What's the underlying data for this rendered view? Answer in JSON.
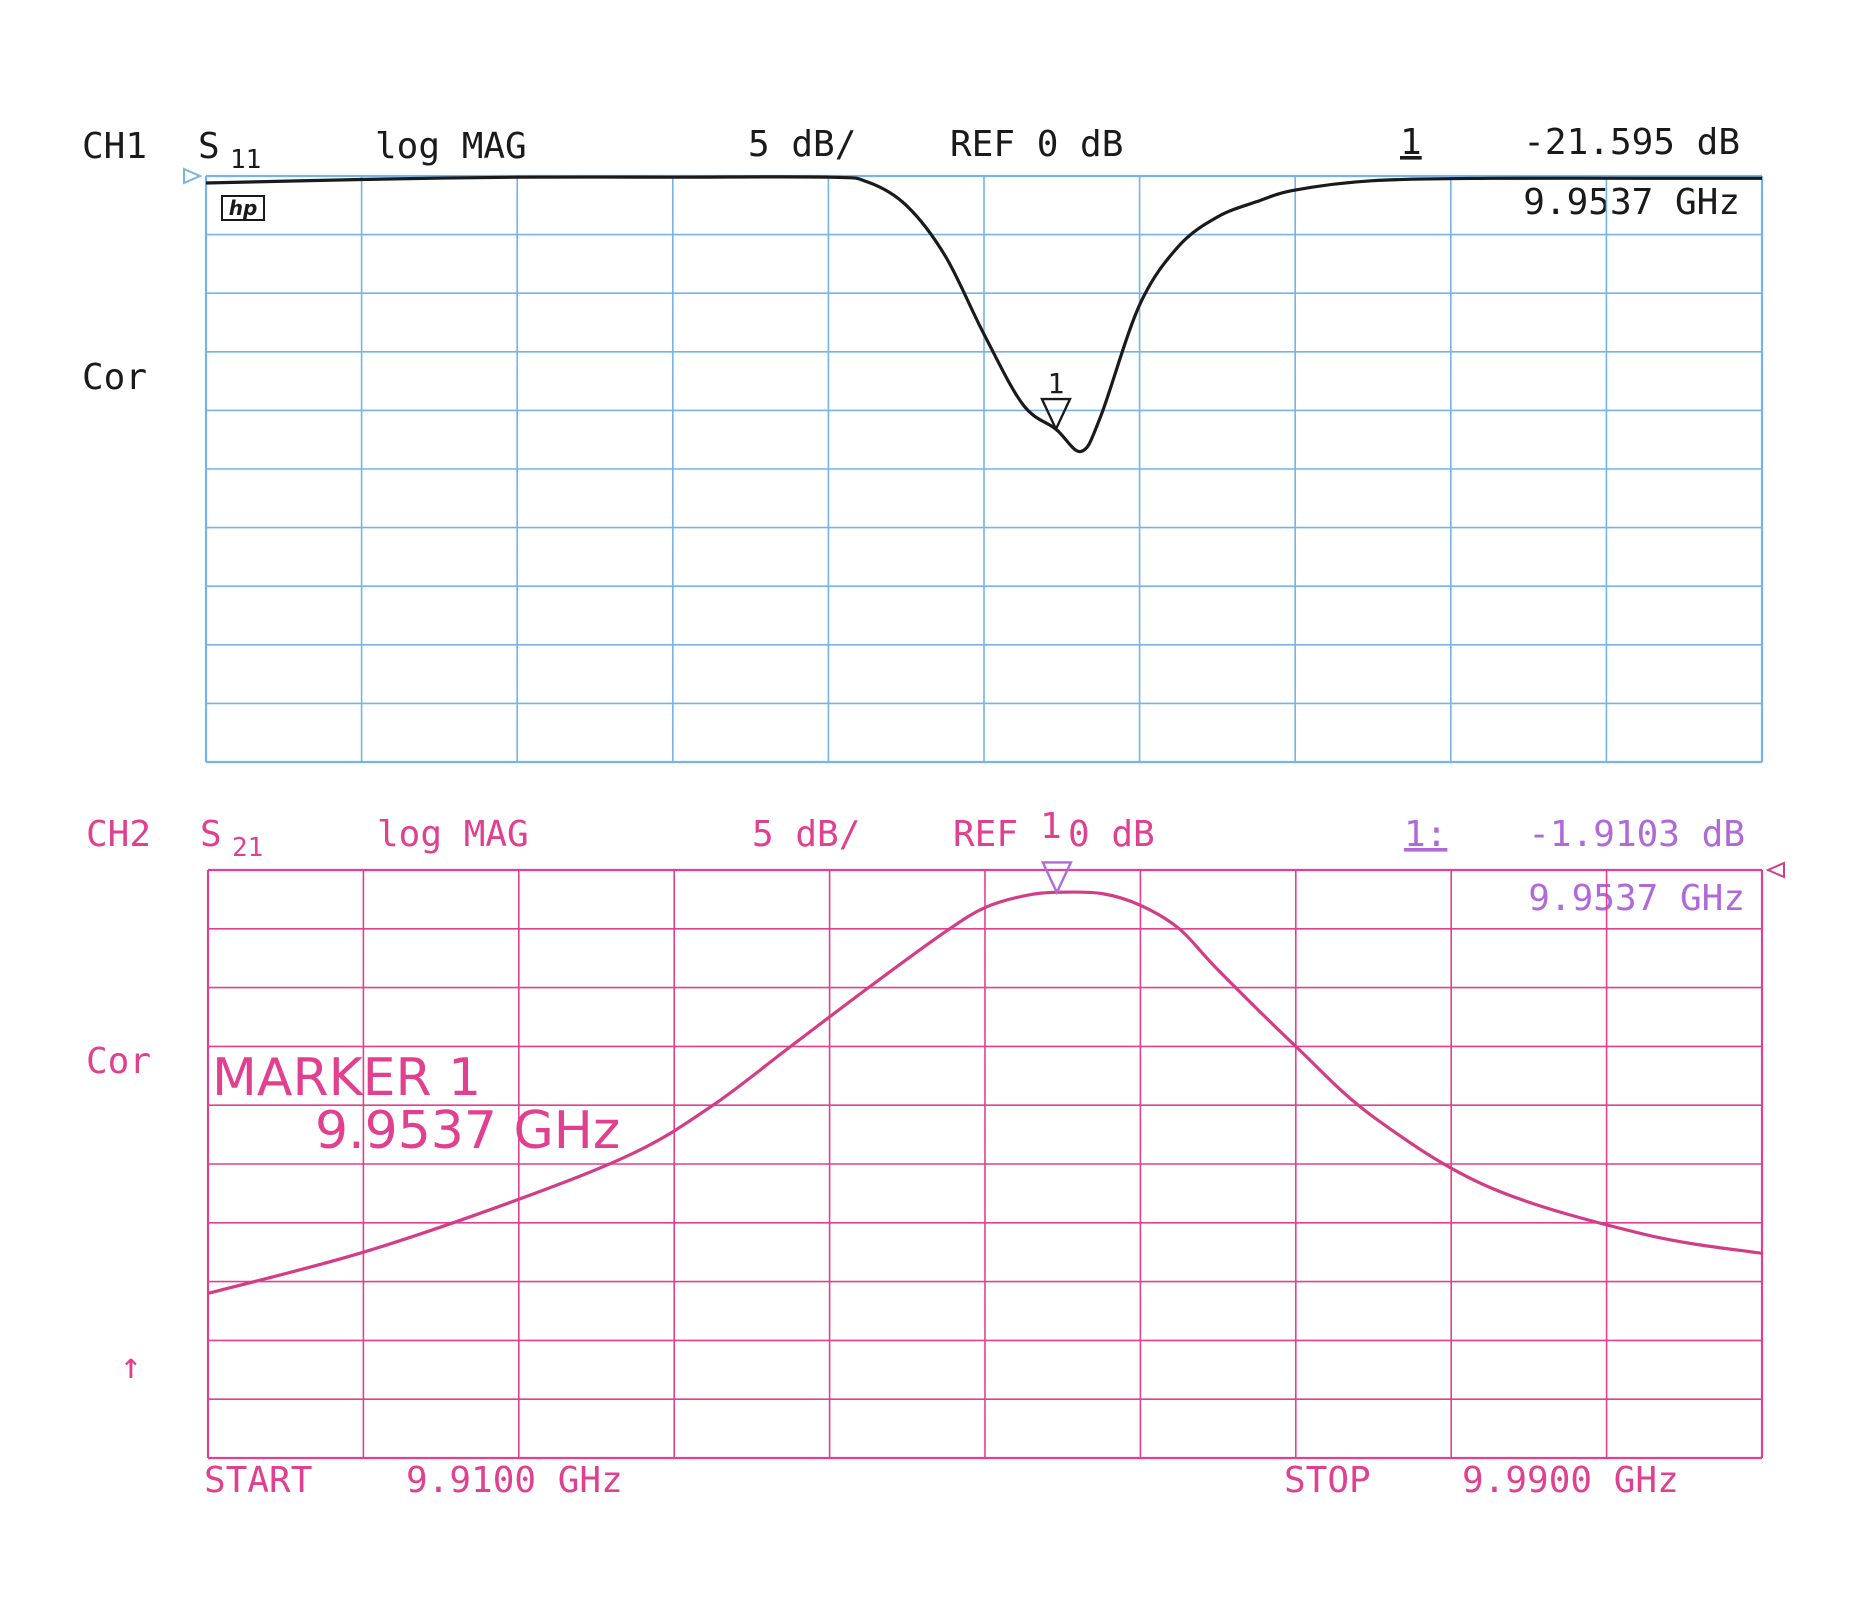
{
  "colors": {
    "ch1_grid": "#74b4e8",
    "ch1_trace": "#1a1a1a",
    "ch2_grid": "#e0408f",
    "ch2_trace": "#d23d86",
    "ch2_marker_readout": "#b06ad8"
  },
  "icons": {
    "hp_logo": "hp-logo-icon",
    "marker": "triangle-marker-icon",
    "ref_arrow": "up-arrow-icon"
  },
  "ch1": {
    "channel": "CH1",
    "param": "S",
    "param_sub": "11",
    "format": "log MAG",
    "scale": "5 dB/",
    "ref": "REF 0 dB",
    "marker_no": "1",
    "marker_value": "-21.595 dB",
    "marker_freq": "9.9537 GHz",
    "cor": "Cor",
    "hp_logo_text": "hp"
  },
  "ch2": {
    "channel": "CH2",
    "param": "S",
    "param_sub": "21",
    "format": "log MAG",
    "scale": "5 dB/",
    "ref_a": "REF",
    "ref_marker": "1",
    "ref_b": "0 dB",
    "marker_no": "1:",
    "marker_value": "-1.9103 dB",
    "marker_freq": "9.9537 GHz",
    "cor": "Cor",
    "marker_box_title": "MARKER 1",
    "marker_box_freq": "9.9537 GHz",
    "ref_arrow": "↑"
  },
  "footer": {
    "start_label": "START",
    "start_value": "9.9100 GHz",
    "stop_label": "STOP",
    "stop_value": "9.9900 GHz"
  },
  "chart_data": [
    {
      "type": "line",
      "title": "CH1 S11 log MAG",
      "xlabel": "",
      "ylabel": "",
      "xlim": [
        9.91,
        9.99
      ],
      "ylim": [
        -50,
        0
      ],
      "y_ref": 0,
      "scale_db_per_div": 5,
      "grid": true,
      "series": [
        {
          "x": [
            9.91,
            9.918,
            9.926,
            9.934,
            9.942,
            9.944,
            9.946,
            9.948,
            9.95,
            9.952,
            9.9537,
            9.955,
            9.956,
            9.958,
            9.96,
            9.962,
            9.964,
            9.966,
            9.97,
            9.976,
            9.984,
            9.99
          ],
          "y": [
            -0.6,
            -0.3,
            -0.1,
            -0.1,
            -0.1,
            -0.5,
            -2.5,
            -6.8,
            -13.5,
            -19.5,
            -21.6,
            -23.5,
            -20.5,
            -11.0,
            -6.0,
            -3.5,
            -2.2,
            -1.2,
            -0.4,
            -0.2,
            -0.2,
            -0.2
          ]
        }
      ],
      "markers": [
        {
          "id": "1",
          "x": 9.9537,
          "y": -21.595
        }
      ]
    },
    {
      "type": "line",
      "title": "CH2 S21 log MAG",
      "xlabel": "",
      "ylabel": "",
      "xlim": [
        9.91,
        9.99
      ],
      "ylim": [
        -50,
        0
      ],
      "y_ref": 0,
      "scale_db_per_div": 5,
      "grid": true,
      "series": [
        {
          "x": [
            9.91,
            9.918,
            9.926,
            9.932,
            9.936,
            9.94,
            9.944,
            9.948,
            9.95,
            9.952,
            9.9537,
            9.956,
            9.958,
            9.96,
            9.962,
            9.966,
            9.97,
            9.976,
            9.984,
            9.99
          ],
          "y": [
            -36.0,
            -32.5,
            -28.0,
            -24.0,
            -20.0,
            -15.0,
            -10.0,
            -5.2,
            -3.2,
            -2.2,
            -1.9,
            -2.0,
            -3.0,
            -5.0,
            -8.5,
            -15.0,
            -21.0,
            -27.0,
            -31.0,
            -32.6
          ]
        }
      ],
      "markers": [
        {
          "id": "1",
          "x": 9.9537,
          "y": -1.9103
        }
      ]
    }
  ]
}
